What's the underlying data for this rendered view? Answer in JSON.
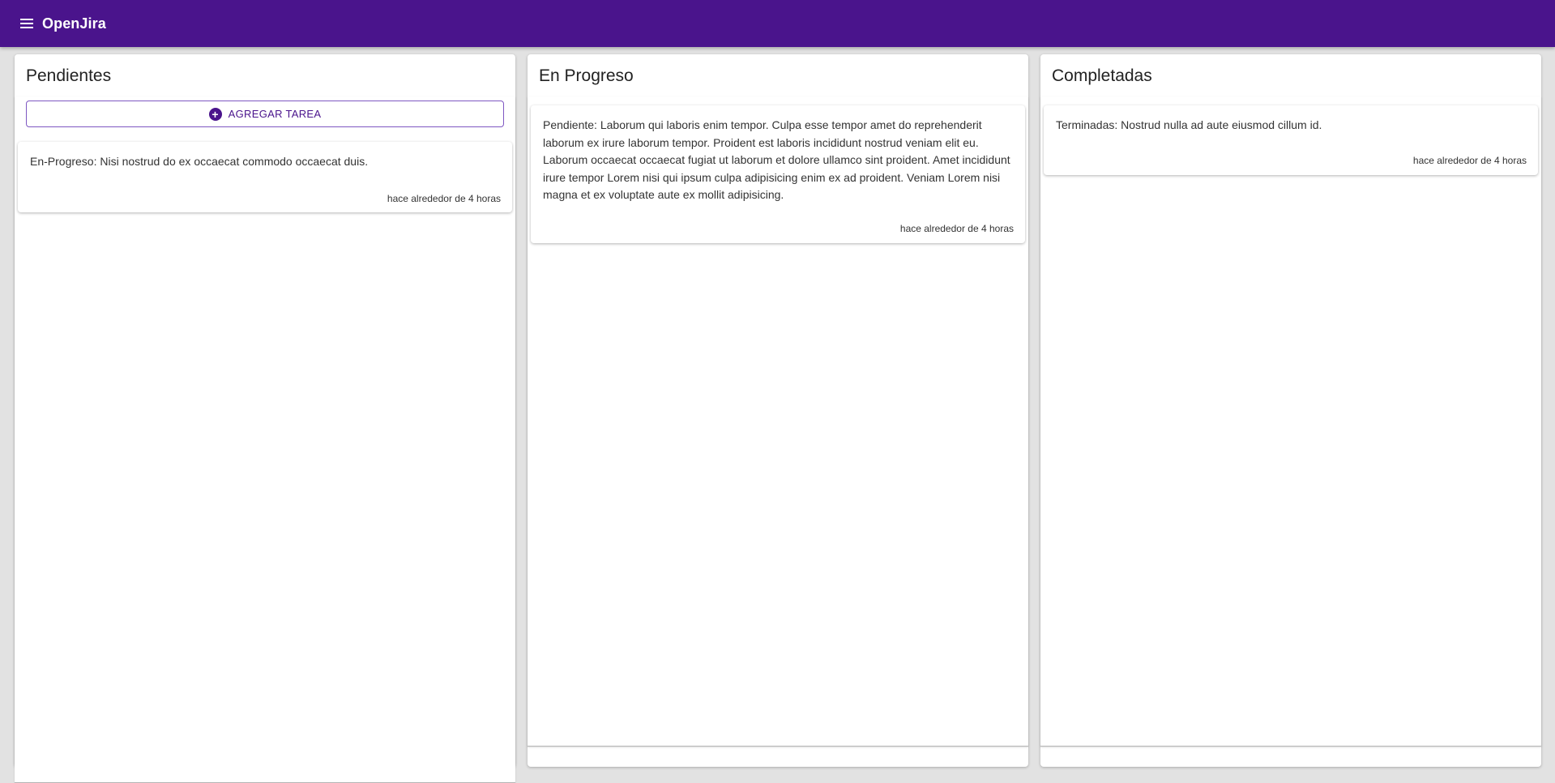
{
  "app": {
    "title": "OpenJira",
    "menu_icon": "menu-icon",
    "brand_color": "#4a148c"
  },
  "columns": [
    {
      "title": "Pendientes",
      "add_button_label": "AGREGAR TAREA",
      "add_button_icon": "add-circle-icon",
      "cards": [
        {
          "description": "En-Progreso: Nisi nostrud do ex occaecat commodo occaecat duis.",
          "time": "hace alrededor de 4 horas"
        }
      ]
    },
    {
      "title": "En Progreso",
      "cards": [
        {
          "description": "Pendiente: Laborum qui laboris enim tempor. Culpa esse tempor amet do reprehenderit laborum ex irure laborum tempor. Proident est laboris incididunt nostrud veniam elit eu. Laborum occaecat occaecat fugiat ut laborum et dolore ullamco sint proident. Amet incididunt irure tempor Lorem nisi qui ipsum culpa adipisicing enim ex ad proident. Veniam Lorem nisi magna et ex voluptate aute ex mollit adipisicing.",
          "time": "hace alrededor de 4 horas"
        }
      ]
    },
    {
      "title": "Completadas",
      "cards": [
        {
          "description": "Terminadas: Nostrud nulla ad aute eiusmod cillum id.",
          "time": "hace alrededor de 4 horas"
        }
      ]
    }
  ]
}
